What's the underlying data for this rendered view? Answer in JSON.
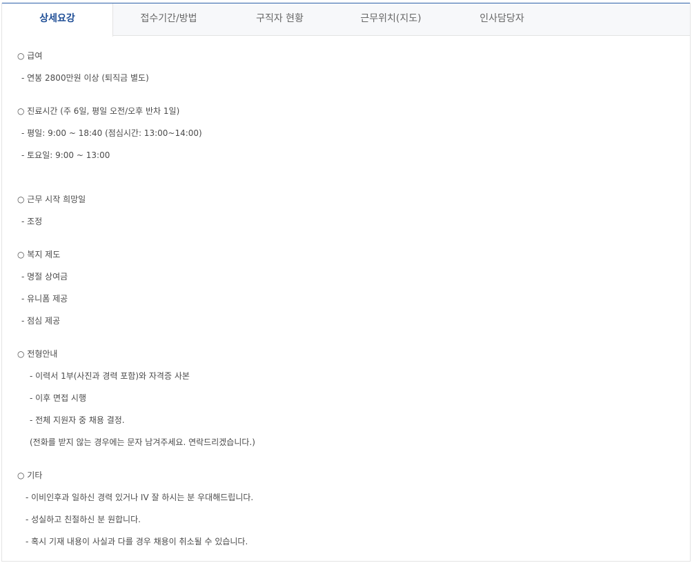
{
  "tabs": [
    {
      "label": "상세요강"
    },
    {
      "label": "접수기간/방법"
    },
    {
      "label": "구직자 현황"
    },
    {
      "label": "근무위치(지도)"
    },
    {
      "label": "인사담당자"
    }
  ],
  "details": {
    "salary_heading": "○ 급여",
    "salary_line": "-  연봉 2800만원 이상 (퇴직금 별도)",
    "hours_heading": "○ 진료시간 (주 6일, 평일 오전/오후 반차 1일)",
    "hours_weekday": "- 평일: 9:00 ~ 18:40 (점심시간: 13:00~14:00)",
    "hours_saturday": "- 토요일: 9:00 ~ 13:00",
    "start_heading": "○ 근무 시작 희망일",
    "start_line": "- 조정",
    "welfare_heading": "○ 복지 제도",
    "welfare_1": "- 명절 상여금",
    "welfare_2": "- 유니폼 제공",
    "welfare_3": "- 점심 제공",
    "process_heading": "○ 전형안내",
    "process_1": "- 이력서 1부(사진과 경력 포함)와 자격증 사본",
    "process_2": "- 이후 면접 시행",
    "process_3": "- 전체 지원자 중 채용 결정.",
    "process_note": "(전화를 받지 않는 경우에는 문자 남겨주세요. 연락드리겠습니다.)",
    "etc_heading": "○ 기타",
    "etc_1": "- 이비인후과 일하신 경력 있거나 IV 잘 하시는 분 우대해드립니다.",
    "etc_2": "- 성실하고 친절하신 분 원합니다.",
    "etc_3": "- 혹시 기재 내용이 사실과 다를 경우 채용이 취소될 수 있습니다."
  }
}
